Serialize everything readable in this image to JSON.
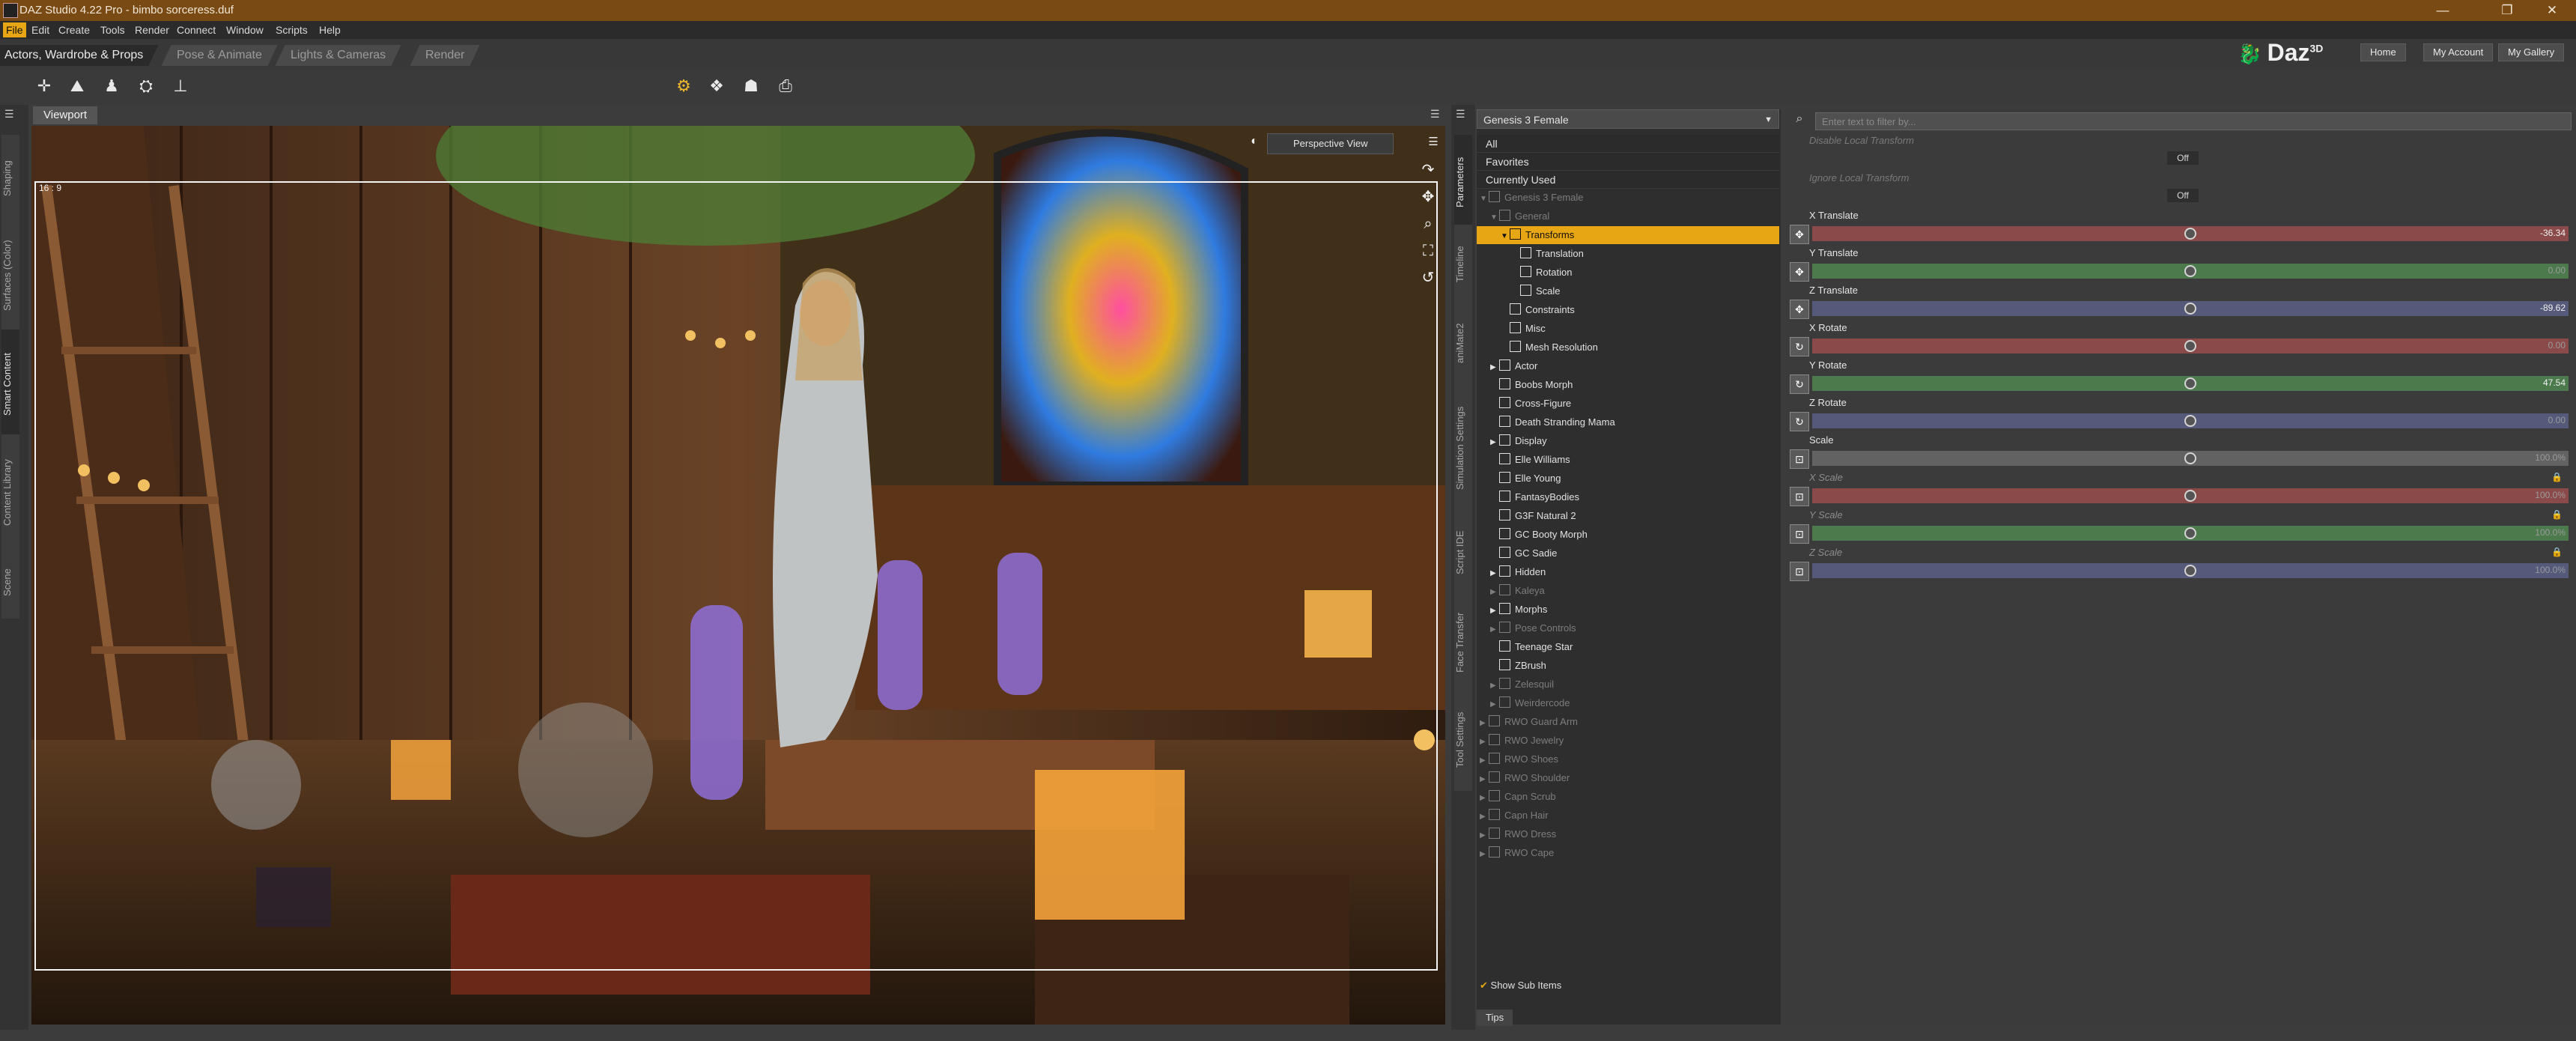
{
  "window": {
    "title": "DAZ Studio 4.22 Pro - bimbo sorceress.duf"
  },
  "menu": [
    "File",
    "Edit",
    "Create",
    "Tools",
    "Render",
    "Connect",
    "Window",
    "Scripts",
    "Help"
  ],
  "room_tabs": [
    "Actors, Wardrobe & Props",
    "Pose & Animate",
    "Lights & Cameras",
    "Render"
  ],
  "top_links": [
    "Home",
    "My Account",
    "My Gallery"
  ],
  "brand": "Daz",
  "brand_sup": "3D",
  "left_tabs": [
    "Shaping",
    "Surfaces (Color)",
    "Smart Content",
    "Content Library",
    "Scene"
  ],
  "right_tabs": [
    "Parameters",
    "Timeline",
    "aniMate2",
    "Simulation Settings",
    "Script IDE",
    "Face Transfer",
    "Tool Settings"
  ],
  "viewport": {
    "tab": "Viewport",
    "camera": "Perspective View",
    "aspect": "16 : 9"
  },
  "scene_panel": {
    "figure": "Genesis 3 Female",
    "filters": [
      "All",
      "Favorites",
      "Currently Used"
    ],
    "tree": [
      {
        "label": "Genesis 3 Female",
        "indent": 0,
        "arrow": "▼",
        "dim": true
      },
      {
        "label": "General",
        "indent": 1,
        "arrow": "▼",
        "dim": true
      },
      {
        "label": "Transforms",
        "indent": 2,
        "arrow": "▼",
        "selected": true
      },
      {
        "label": "Translation",
        "indent": 3
      },
      {
        "label": "Rotation",
        "indent": 3
      },
      {
        "label": "Scale",
        "indent": 3
      },
      {
        "label": "Constraints",
        "indent": 2
      },
      {
        "label": "Misc",
        "indent": 2
      },
      {
        "label": "Mesh Resolution",
        "indent": 2
      },
      {
        "label": "Actor",
        "indent": 1,
        "arrow": "▶"
      },
      {
        "label": "Boobs Morph",
        "indent": 1
      },
      {
        "label": "Cross-Figure",
        "indent": 1
      },
      {
        "label": "Death Stranding Mama",
        "indent": 1
      },
      {
        "label": "Display",
        "indent": 1,
        "arrow": "▶"
      },
      {
        "label": "Elle Williams",
        "indent": 1
      },
      {
        "label": "Elle Young",
        "indent": 1
      },
      {
        "label": "FantasyBodies",
        "indent": 1
      },
      {
        "label": "G3F Natural 2",
        "indent": 1
      },
      {
        "label": "GC Booty Morph",
        "indent": 1
      },
      {
        "label": "GC Sadie",
        "indent": 1
      },
      {
        "label": "Hidden",
        "indent": 1,
        "arrow": "▶"
      },
      {
        "label": "Kaleya",
        "indent": 1,
        "arrow": "▶",
        "dim": true
      },
      {
        "label": "Morphs",
        "indent": 1,
        "arrow": "▶"
      },
      {
        "label": "Pose Controls",
        "indent": 1,
        "arrow": "▶",
        "dim": true
      },
      {
        "label": "Teenage Star",
        "indent": 1
      },
      {
        "label": "ZBrush",
        "indent": 1
      },
      {
        "label": "Zelesquil",
        "indent": 1,
        "arrow": "▶",
        "dim": true
      },
      {
        "label": "Weirdercode",
        "indent": 1,
        "arrow": "▶",
        "dim": true
      },
      {
        "label": "RWO Guard Arm",
        "indent": 0,
        "arrow": "▶",
        "dim": true
      },
      {
        "label": "RWO Jewelry",
        "indent": 0,
        "arrow": "▶",
        "dim": true
      },
      {
        "label": "RWO Shoes",
        "indent": 0,
        "arrow": "▶",
        "dim": true
      },
      {
        "label": "RWO Shoulder",
        "indent": 0,
        "arrow": "▶",
        "dim": true
      },
      {
        "label": "Capn Scrub",
        "indent": 0,
        "arrow": "▶",
        "dim": true
      },
      {
        "label": "Capn Hair",
        "indent": 0,
        "arrow": "▶",
        "dim": true
      },
      {
        "label": "RWO Dress",
        "indent": 0,
        "arrow": "▶",
        "dim": true
      },
      {
        "label": "RWO Cape",
        "indent": 0,
        "arrow": "▶",
        "dim": true
      }
    ],
    "show_sub_items": "Show Sub Items",
    "tips": "Tips"
  },
  "parameters": {
    "filter_placeholder": "Enter text to filter by...",
    "booleans": [
      {
        "label": "Disable Local Transform",
        "value": "Off"
      },
      {
        "label": "Ignore Local Transform",
        "value": "Off"
      }
    ],
    "sliders": [
      {
        "label": "X Translate",
        "value": "-36.34",
        "fraction": 0.5,
        "color": "#8b4a4a",
        "icon": "✥"
      },
      {
        "label": "Y Translate",
        "value": "0.00",
        "fraction": 0.5,
        "color": "#4c7a4c",
        "icon": "✥",
        "dimval": true
      },
      {
        "label": "Z Translate",
        "value": "-89.62",
        "fraction": 0.5,
        "color": "#555a7a",
        "icon": "✥"
      },
      {
        "label": "X Rotate",
        "value": "0.00",
        "fraction": 0.5,
        "color": "#8b4a4a",
        "icon": "↻",
        "dimval": true
      },
      {
        "label": "Y Rotate",
        "value": "47.54",
        "fraction": 0.5,
        "color": "#4c7a4c",
        "icon": "↻"
      },
      {
        "label": "Z Rotate",
        "value": "0.00",
        "fraction": 0.5,
        "color": "#555a7a",
        "icon": "↻",
        "dimval": true
      },
      {
        "label": "Scale",
        "value": "100.0%",
        "fraction": 0.5,
        "color": "#626262",
        "icon": "⊡",
        "dimval": true
      },
      {
        "label": "X Scale",
        "value": "100.0%",
        "fraction": 0.5,
        "color": "#8b4a4a",
        "icon": "⊡",
        "dim": true,
        "locked": true,
        "dimval": true
      },
      {
        "label": "Y Scale",
        "value": "100.0%",
        "fraction": 0.5,
        "color": "#4c7a4c",
        "icon": "⊡",
        "dim": true,
        "locked": true,
        "dimval": true
      },
      {
        "label": "Z Scale",
        "value": "100.0%",
        "fraction": 0.5,
        "color": "#555a7a",
        "icon": "⊡",
        "dim": true,
        "locked": true,
        "dimval": true
      }
    ]
  },
  "colors": {
    "accent": "#e7a613",
    "titlebar": "#7a4a14"
  }
}
